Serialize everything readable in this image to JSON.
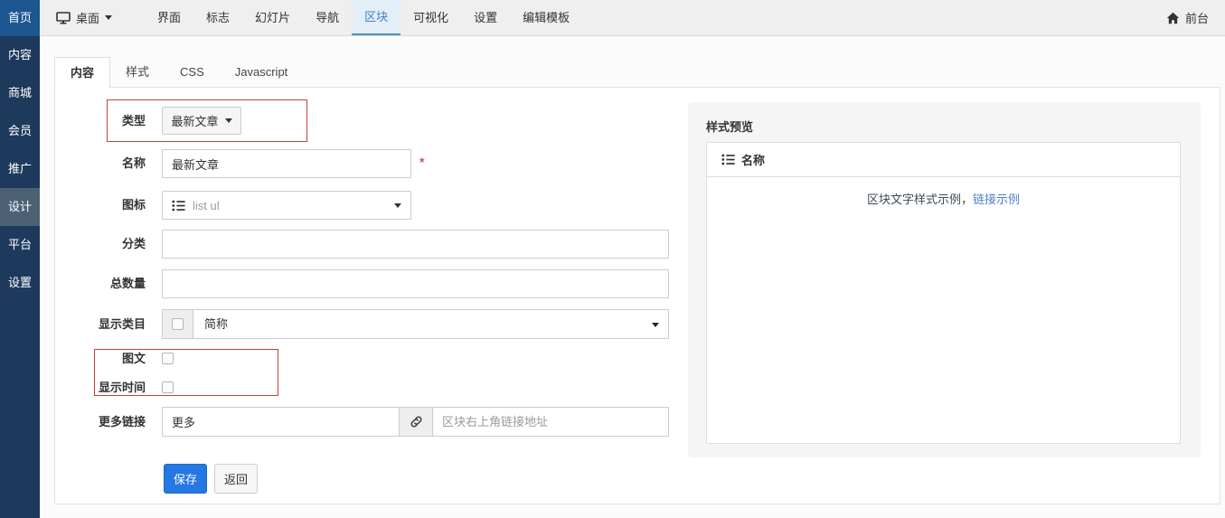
{
  "sidebar": {
    "items": [
      "首页",
      "内容",
      "商城",
      "会员",
      "推广",
      "设计",
      "平台",
      "设置"
    ]
  },
  "topbar": {
    "desktop_label": "桌面",
    "menu": [
      "界面",
      "标志",
      "幻灯片",
      "导航",
      "区块",
      "可视化",
      "设置",
      "编辑模板"
    ],
    "active_item": "区块",
    "front_label": "前台"
  },
  "tabs": [
    "内容",
    "样式",
    "CSS",
    "Javascript"
  ],
  "active_tab": "内容",
  "form": {
    "type": {
      "label": "类型",
      "value": "最新文章"
    },
    "name": {
      "label": "名称",
      "value": "最新文章",
      "required_mark": "*"
    },
    "icon": {
      "label": "图标",
      "value": "list ul"
    },
    "category": {
      "label": "分类",
      "value": ""
    },
    "total": {
      "label": "总数量",
      "value": ""
    },
    "display_category": {
      "label": "显示类目",
      "value": "简称",
      "checked": false
    },
    "image_text": {
      "label": "图文",
      "checked": false
    },
    "show_time": {
      "label": "显示时间",
      "checked": false
    },
    "more_link": {
      "label": "更多链接",
      "text_value": "更多",
      "url_value": "",
      "url_placeholder": "区块右上角链接地址"
    },
    "save_label": "保存",
    "back_label": "返回"
  },
  "preview": {
    "title": "样式预览",
    "box_title": "名称",
    "sample_text": "区块文字样式示例，",
    "sample_link": "链接示例"
  },
  "icons": {
    "desktop": "monitor-icon",
    "desktop_caret": "caret-down-icon",
    "front": "home-icon",
    "type_caret": "caret-down-icon",
    "icon_field": "list-ul-icon",
    "icon_field_caret": "caret-down-icon",
    "display_category_arrow": "caret-down-icon",
    "more_link_addon": "link-icon",
    "preview_header": "list-ul-icon"
  },
  "colors": {
    "sidebar_bg": "#1d3a5c",
    "sidebar_home_active": "#1c5691",
    "sidebar_item_active": "#4d6175",
    "topbar_bg": "#efefef",
    "topbar_active_text": "#3e82c4",
    "topbar_active_underline": "#4a90d9",
    "primary_button": "#2577e3",
    "required_mark": "#d9534f",
    "preview_link": "#4f81c7",
    "annotation_box": "#c4423a"
  },
  "annotations": {
    "boxes": [
      "type-row-highlight",
      "checkbox-rows-highlight"
    ]
  }
}
